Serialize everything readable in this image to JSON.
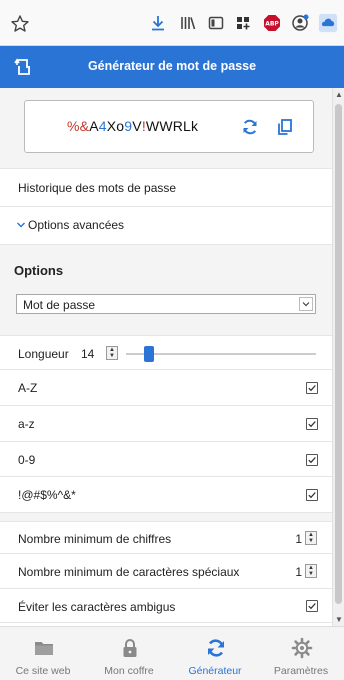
{
  "header": {
    "title": "Générateur de mot de passe"
  },
  "password": {
    "parts": [
      {
        "t": "%&",
        "k": "sp"
      },
      {
        "t": "A",
        "k": "lt"
      },
      {
        "t": "4",
        "k": "dg"
      },
      {
        "t": "Xo",
        "k": "lt"
      },
      {
        "t": "9",
        "k": "dg"
      },
      {
        "t": "V",
        "k": "lt"
      },
      {
        "t": "!",
        "k": "sp"
      },
      {
        "t": "WWRLk",
        "k": "lt"
      }
    ]
  },
  "links": {
    "history": "Historique des mots de passe",
    "advanced": "Options avancées"
  },
  "options": {
    "heading": "Options",
    "type_value": "Mot de passe",
    "length_label": "Longueur",
    "length_value": "14",
    "length_fraction": 0.12,
    "toggles": [
      {
        "label": "A-Z",
        "checked": true
      },
      {
        "label": "a-z",
        "checked": true
      },
      {
        "label": "0-9",
        "checked": true
      },
      {
        "label": "!@#$%^&*",
        "checked": true
      }
    ],
    "min_numbers_label": "Nombre minimum de chiffres",
    "min_numbers_value": "1",
    "min_special_label": "Nombre minimum de caractères spéciaux",
    "min_special_value": "1",
    "avoid_ambiguous_label": "Éviter les caractères ambigus",
    "avoid_ambiguous_checked": true
  },
  "tabs": [
    {
      "label": "Ce site web",
      "icon": "folder-icon",
      "active": false
    },
    {
      "label": "Mon coffre",
      "icon": "lock-icon",
      "active": false
    },
    {
      "label": "Générateur",
      "icon": "refresh-icon",
      "active": true
    },
    {
      "label": "Paramètres",
      "icon": "gear-icon",
      "active": false
    }
  ],
  "colors": {
    "accent": "#2a74d6",
    "special": "#c0392b"
  }
}
